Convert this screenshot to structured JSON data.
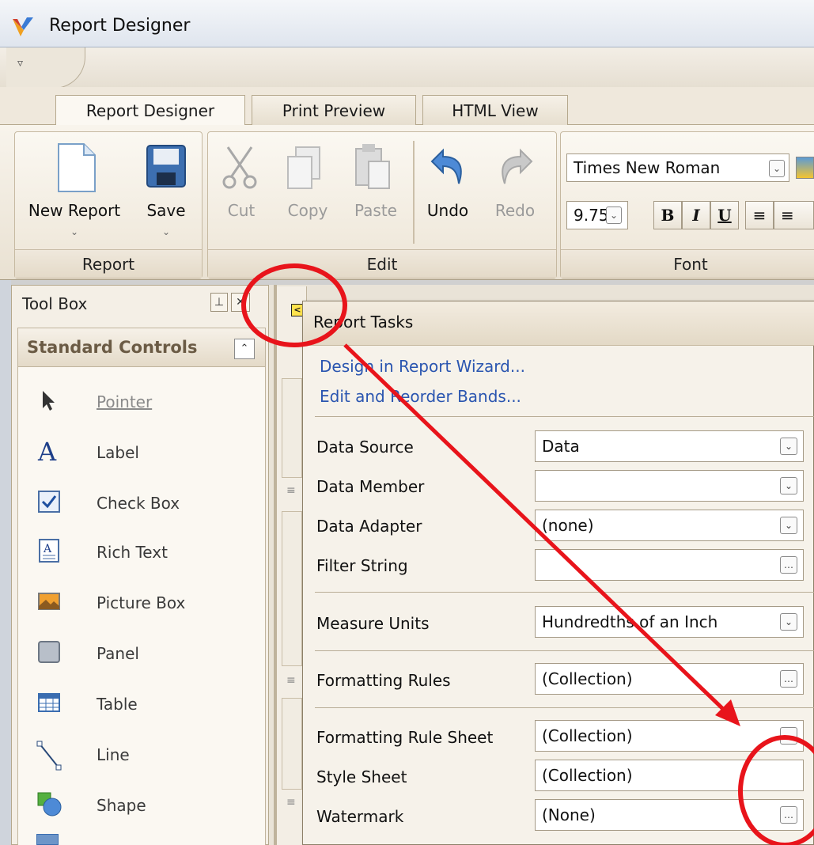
{
  "window": {
    "title": "Report Designer"
  },
  "qat": {
    "dropdown_glyph": "▿"
  },
  "tabs": [
    {
      "label": "Report Designer",
      "active": true
    },
    {
      "label": "Print Preview",
      "active": false
    },
    {
      "label": "HTML View",
      "active": false
    }
  ],
  "ribbon": {
    "report_group": {
      "caption": "Report",
      "new_report": "New Report",
      "save": "Save"
    },
    "edit_group": {
      "caption": "Edit",
      "cut": "Cut",
      "copy": "Copy",
      "paste": "Paste",
      "undo": "Undo",
      "redo": "Redo"
    },
    "font_group": {
      "caption": "Font",
      "font_name": "Times New Roman",
      "font_size": "9.75",
      "bold": "B",
      "italic": "I",
      "underline": "U"
    }
  },
  "toolbox": {
    "title": "Tool Box",
    "section": "Standard Controls",
    "items": [
      "Pointer",
      "Label",
      "Check Box",
      "Rich Text",
      "Picture Box",
      "Panel",
      "Table",
      "Line",
      "Shape"
    ]
  },
  "tasks": {
    "title": "Report Tasks",
    "links": [
      "Design in Report Wizard...",
      "Edit and Reorder Bands..."
    ],
    "properties": [
      {
        "label": "Data Source",
        "value": "Data",
        "button": "dropdown"
      },
      {
        "label": "Data Member",
        "value": "",
        "button": "dropdown"
      },
      {
        "label": "Data Adapter",
        "value": "(none)",
        "button": "dropdown"
      },
      {
        "label": "Filter String",
        "value": "",
        "button": "ellipsis"
      },
      {
        "label": "Measure Units",
        "value": "Hundredths of an Inch",
        "button": "dropdown"
      },
      {
        "label": "Formatting Rules",
        "value": "(Collection)",
        "button": "ellipsis"
      },
      {
        "label": "Formatting Rule Sheet",
        "value": "(Collection)",
        "button": "ellipsis"
      },
      {
        "label": "Style Sheet",
        "value": "(Collection)",
        "button": "none"
      },
      {
        "label": "Watermark",
        "value": "(None)",
        "button": "ellipsis"
      }
    ]
  },
  "colors": {
    "annotation": "#e8141b",
    "link": "#2a55b0",
    "group_caption_bg": "#e4dac8"
  }
}
